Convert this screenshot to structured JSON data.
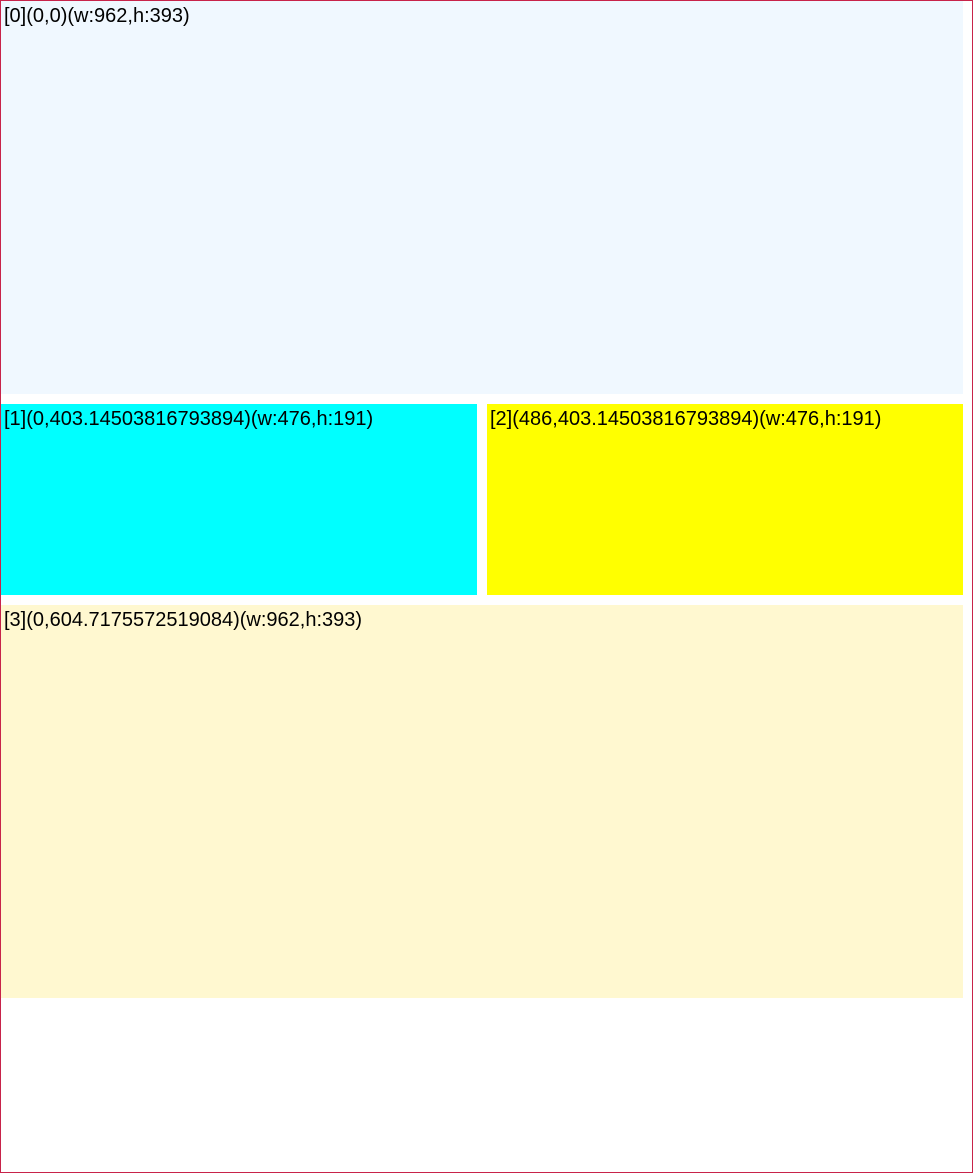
{
  "boxes": [
    {
      "label": "[0](0,0)(w:962,h:393)",
      "color": "#f0f8ff"
    },
    {
      "label": "[1](0,403.14503816793894)(w:476,h:191)",
      "color": "#00ffff"
    },
    {
      "label": "[2](486,403.14503816793894)(w:476,h:191)",
      "color": "#ffff00"
    },
    {
      "label": "[3](0,604.7175572519084)(w:962,h:393)",
      "color": "#fff8d0"
    }
  ],
  "colors": {
    "frame_border": "#c8234a",
    "background": "#ffffff"
  }
}
